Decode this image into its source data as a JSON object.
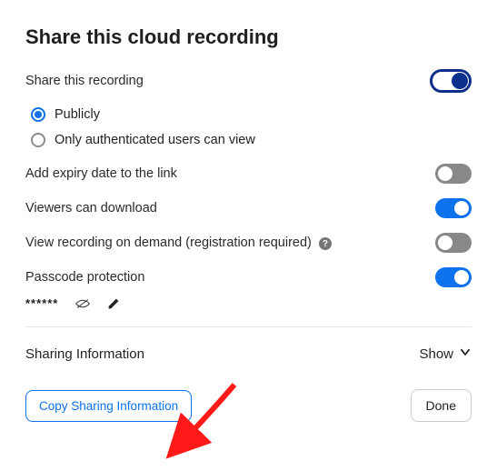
{
  "title": "Share this cloud recording",
  "share_recording_label": "Share this recording",
  "radio": {
    "publicly": "Publicly",
    "auth_only": "Only authenticated users can view"
  },
  "options": {
    "expiry": "Add expiry date to the link",
    "download": "Viewers can download",
    "on_demand": "View recording on demand (registration required)",
    "passcode": "Passcode protection"
  },
  "passcode_masked": "******",
  "sharing_info_label": "Sharing Information",
  "show_label": "Show",
  "copy_button": "Copy Sharing Information",
  "done_button": "Done"
}
